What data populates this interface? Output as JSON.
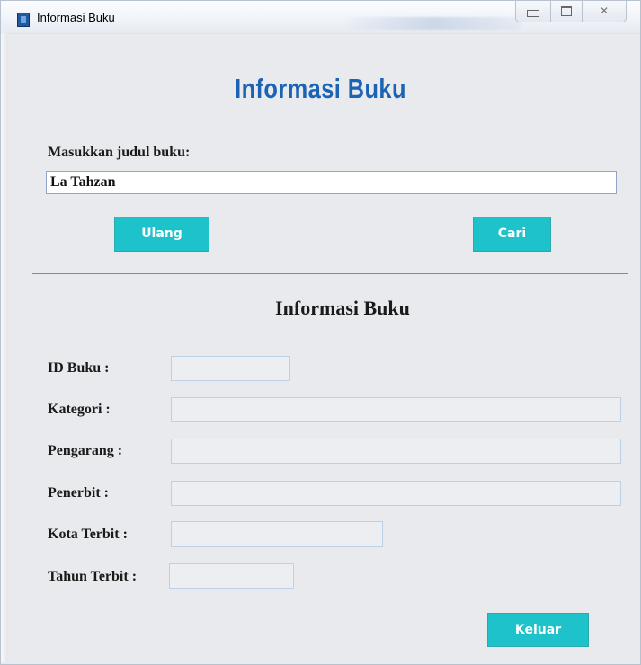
{
  "window": {
    "title": "Informasi Buku"
  },
  "form": {
    "heading": "Informasi Buku",
    "input_label": "Masukkan judul buku:",
    "input_value": "La Tahzan",
    "reset_button": "Ulang",
    "search_button": "Cari"
  },
  "details": {
    "heading": "Informasi Buku",
    "fields": [
      {
        "label": "ID Buku :",
        "value": ""
      },
      {
        "label": "Kategori :",
        "value": ""
      },
      {
        "label": "Pengarang :",
        "value": ""
      },
      {
        "label": "Penerbit :",
        "value": ""
      },
      {
        "label": "Kota Terbit :",
        "value": ""
      },
      {
        "label": "Tahun Terbit :",
        "value": ""
      }
    ],
    "exit_button": "Keluar"
  },
  "colors": {
    "heading": "#1b63b3",
    "button": "#1ec2ca",
    "background": "#e9eaed"
  }
}
